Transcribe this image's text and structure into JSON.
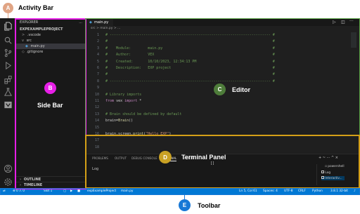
{
  "window_tabs": [
    {
      "label": "main.py"
    }
  ],
  "breadcrumb": "src > main.py > ...",
  "explorer": {
    "header": "EXPLORER",
    "menu": "...",
    "project": "EXPEXAMPLEPROJECT",
    "items": [
      {
        "label": ".vscode",
        "icon": ">"
      },
      {
        "label": "src",
        "icon": "v"
      },
      {
        "label": "main.py"
      },
      {
        "label": ".gitignore"
      }
    ],
    "outline": "OUTLINE",
    "timeline": "TIMELINE"
  },
  "editor": {
    "lines": [
      {
        "n": "1",
        "segs": [
          {
            "t": "# ---------------------------------------------------------------------------- #",
            "c": "c-comment"
          }
        ]
      },
      {
        "n": "2",
        "segs": [
          {
            "t": "#                                                                              #",
            "c": "c-comment"
          }
        ]
      },
      {
        "n": "3",
        "segs": [
          {
            "t": "#    Module:        main.py                                                    #",
            "c": "c-comment"
          }
        ]
      },
      {
        "n": "4",
        "segs": [
          {
            "t": "#    Author:        VEX                                                        #",
            "c": "c-comment"
          }
        ]
      },
      {
        "n": "5",
        "segs": [
          {
            "t": "#    Created:       10/10/2023, 12:34:13 PM                                    #",
            "c": "c-comment"
          }
        ]
      },
      {
        "n": "6",
        "segs": [
          {
            "t": "#    Description:   EXP project                                                #",
            "c": "c-comment"
          }
        ]
      },
      {
        "n": "7",
        "segs": [
          {
            "t": "#                                                                              #",
            "c": "c-comment"
          }
        ]
      },
      {
        "n": "8",
        "segs": [
          {
            "t": "# ---------------------------------------------------------------------------- #",
            "c": "c-comment"
          }
        ]
      },
      {
        "n": "9",
        "segs": [
          {
            "t": "",
            "c": "c-plain"
          }
        ]
      },
      {
        "n": "10",
        "segs": [
          {
            "t": "# Library imports",
            "c": "c-comment"
          }
        ]
      },
      {
        "n": "11",
        "segs": [
          {
            "t": "from ",
            "c": "c-kw"
          },
          {
            "t": "vex ",
            "c": "c-plain"
          },
          {
            "t": "import ",
            "c": "c-kw"
          },
          {
            "t": "*",
            "c": "c-plain"
          }
        ]
      },
      {
        "n": "12",
        "segs": [
          {
            "t": "",
            "c": "c-plain"
          }
        ]
      },
      {
        "n": "13",
        "segs": [
          {
            "t": "# Brain should be defined by default",
            "c": "c-comment"
          }
        ]
      },
      {
        "n": "14",
        "segs": [
          {
            "t": "brain=",
            "c": "c-plain"
          },
          {
            "t": "Brain",
            "c": "c-fn"
          },
          {
            "t": "()",
            "c": "c-plain"
          }
        ]
      },
      {
        "n": "15",
        "segs": [
          {
            "t": "",
            "c": "c-plain"
          }
        ]
      },
      {
        "n": "16",
        "segs": [
          {
            "t": "brain.screen.",
            "c": "c-plain"
          },
          {
            "t": "print",
            "c": "c-fn"
          },
          {
            "t": "(",
            "c": "c-plain"
          },
          {
            "t": "\"Hello EXP\"",
            "c": "c-str"
          },
          {
            "t": ")",
            "c": "c-plain"
          }
        ]
      },
      {
        "n": "17",
        "segs": [
          {
            "t": "",
            "c": "c-plain"
          }
        ]
      },
      {
        "n": "18",
        "segs": [
          {
            "t": "",
            "c": "c-plain"
          }
        ]
      }
    ]
  },
  "terminal": {
    "tabs": [
      "PROBLEMS",
      "OUTPUT",
      "DEBUG CONSOLE",
      "TERMINAL",
      "PORTS"
    ],
    "active_tab": "TERMINAL",
    "content": "Log",
    "cursor": "[]",
    "list": [
      "powershell",
      "Log",
      "Interactiv..."
    ],
    "actions": "+ ~ ··· ^ ×"
  },
  "status_bar": {
    "left": [
      "⊗ 0 ⚠ 0",
      "Slot 1",
      "expExampleProject",
      "main.py"
    ],
    "right": [
      "Ln 5, Col 61",
      "Spaces: 4",
      "UTF-8",
      "CRLF",
      "Python",
      "3.8.1 32-bit"
    ]
  },
  "callouts": [
    {
      "letter": "A",
      "label": "Activity Bar",
      "color": "#e0a484"
    },
    {
      "letter": "B",
      "label": "Side Bar",
      "color": "#e61fe6"
    },
    {
      "letter": "C",
      "label": "Editor",
      "color": "#4e7d3a"
    },
    {
      "letter": "D",
      "label": "Terminal Panel",
      "color": "#c9a124"
    },
    {
      "letter": "E",
      "label": "Toolbar",
      "color": "#1878d6"
    }
  ],
  "colors": {
    "side_bar_highlight": "#e61fe6",
    "editor_highlight": "#5aa245",
    "terminal_highlight": "#d4a017",
    "toolbar_highlight": "#1878d6",
    "status_bar": "#0078d4"
  }
}
